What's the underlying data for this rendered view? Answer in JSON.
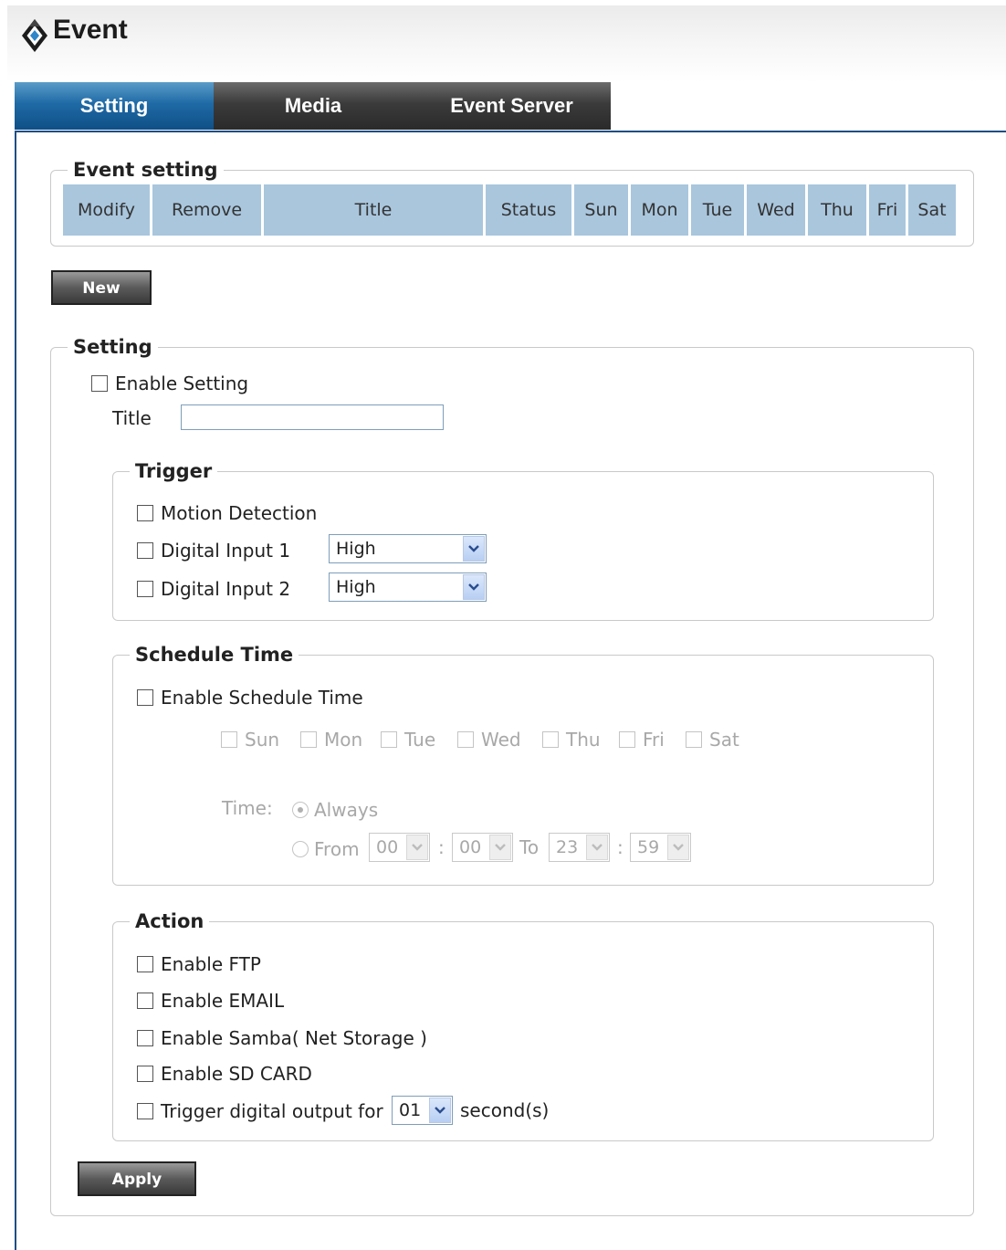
{
  "header": {
    "title": "Event",
    "logo_icon": "event-logo-icon"
  },
  "tabs": [
    {
      "label": "Setting",
      "active": true
    },
    {
      "label": "Media",
      "active": false
    },
    {
      "label": "Event Server",
      "active": false
    }
  ],
  "event_setting": {
    "legend": "Event setting",
    "columns": [
      "Modify",
      "Remove",
      "Title",
      "Status",
      "Sun",
      "Mon",
      "Tue",
      "Wed",
      "Thu",
      "Fri",
      "Sat"
    ]
  },
  "new_button": "New",
  "setting": {
    "legend": "Setting",
    "enable_label": "Enable Setting",
    "title_label": "Title",
    "title_value": ""
  },
  "trigger": {
    "legend": "Trigger",
    "motion_label": "Motion Detection",
    "di1_label": "Digital Input 1",
    "di1_value": "High",
    "di2_label": "Digital Input 2",
    "di2_value": "High"
  },
  "schedule": {
    "legend": "Schedule Time",
    "enable_label": "Enable Schedule Time",
    "days": [
      "Sun",
      "Mon",
      "Tue",
      "Wed",
      "Thu",
      "Fri",
      "Sat"
    ],
    "time_label": "Time:",
    "always_label": "Always",
    "from_label": "From",
    "from_hour": "00",
    "from_minute": "00",
    "to_label": "To",
    "to_hour": "23",
    "to_minute": "59",
    "colon": ":"
  },
  "action": {
    "legend": "Action",
    "ftp_label": "Enable FTP",
    "email_label": "Enable EMAIL",
    "samba_label": "Enable Samba( Net Storage )",
    "sd_label": "Enable SD CARD",
    "trigger_do_label": "Trigger digital output for",
    "trigger_do_value": "01",
    "seconds_label": "second(s)"
  },
  "apply_button": "Apply",
  "colors": {
    "tab_active": "#1f6aa6",
    "tab_inactive": "#3b3b3b",
    "table_header": "#a9c6dd"
  }
}
